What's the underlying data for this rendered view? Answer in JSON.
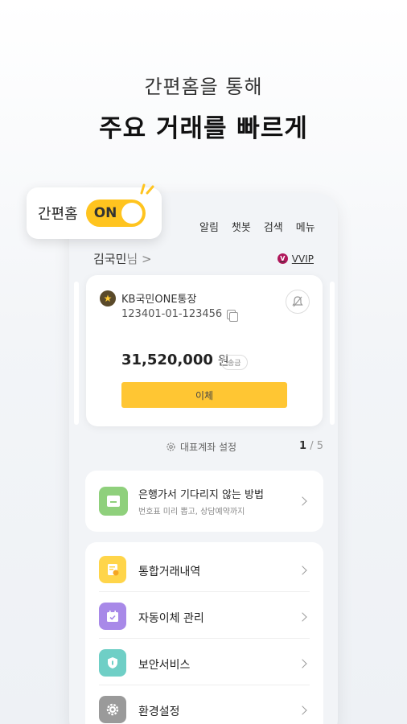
{
  "headline": {
    "sub": "간편홈을 통해",
    "main": "주요 거래를 빠르게"
  },
  "toggle": {
    "label": "간편홈",
    "state": "ON",
    "color": "#ffc41f"
  },
  "topnav": {
    "items": [
      "알림",
      "챗봇",
      "검색",
      "메뉴"
    ]
  },
  "user": {
    "name": "김국민",
    "suffix": "님 >",
    "grade": "VVIP"
  },
  "account": {
    "name": "KB국민ONE통장",
    "number": "123401-01-123456",
    "balance": "31,520,000",
    "unit": "원",
    "send_chip": "송금",
    "transfer_label": "이체"
  },
  "representative": {
    "label": "대표계좌 설정",
    "page_current": "1",
    "page_total": "/ 5"
  },
  "info": {
    "title": "은행가서 기다리지 않는 방법",
    "subtitle": "번호표 미리 뽑고, 상담예약까지"
  },
  "menu": {
    "items": [
      {
        "label": "통합거래내역",
        "icon": "document-icon",
        "color": "#ffd54a"
      },
      {
        "label": "자동이체 관리",
        "icon": "calendar-icon",
        "color": "#a889e8"
      },
      {
        "label": "보안서비스",
        "icon": "shield-icon",
        "color": "#6fcfc6"
      },
      {
        "label": "환경설정",
        "icon": "gear-icon",
        "color": "#9a9a9a"
      }
    ]
  }
}
